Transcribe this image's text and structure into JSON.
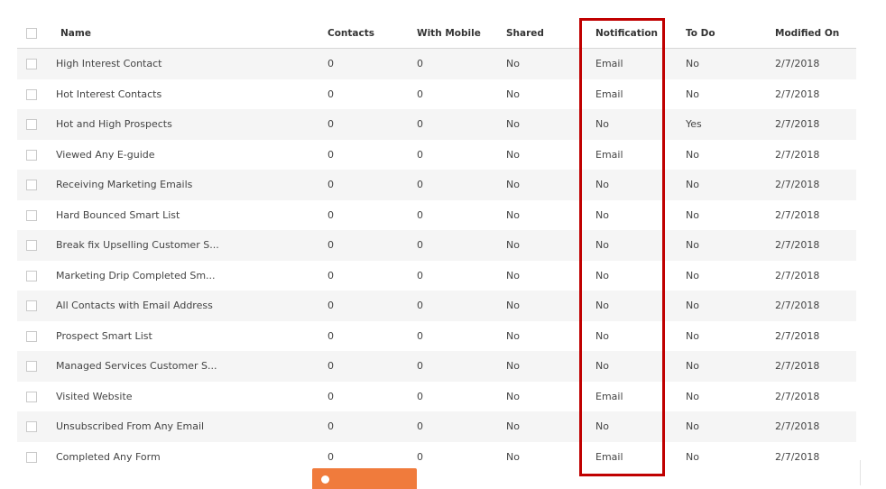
{
  "table": {
    "headers": {
      "name": "Name",
      "contacts": "Contacts",
      "with_mobile": "With Mobile",
      "shared": "Shared",
      "notification": "Notification",
      "to_do": "To Do",
      "modified_on": "Modified On"
    },
    "rows": [
      {
        "name": "High Interest Contact",
        "contacts": "0",
        "with_mobile": "0",
        "shared": "No",
        "notification": "Email",
        "to_do": "No",
        "modified_on": "2/7/2018"
      },
      {
        "name": "Hot Interest Contacts",
        "contacts": "0",
        "with_mobile": "0",
        "shared": "No",
        "notification": "Email",
        "to_do": "No",
        "modified_on": "2/7/2018"
      },
      {
        "name": "Hot and High Prospects",
        "contacts": "0",
        "with_mobile": "0",
        "shared": "No",
        "notification": "No",
        "to_do": "Yes",
        "modified_on": "2/7/2018"
      },
      {
        "name": "Viewed Any E-guide",
        "contacts": "0",
        "with_mobile": "0",
        "shared": "No",
        "notification": "Email",
        "to_do": "No",
        "modified_on": "2/7/2018"
      },
      {
        "name": "Receiving Marketing Emails",
        "contacts": "0",
        "with_mobile": "0",
        "shared": "No",
        "notification": "No",
        "to_do": "No",
        "modified_on": "2/7/2018"
      },
      {
        "name": "Hard Bounced Smart List",
        "contacts": "0",
        "with_mobile": "0",
        "shared": "No",
        "notification": "No",
        "to_do": "No",
        "modified_on": "2/7/2018"
      },
      {
        "name": "Break fix Upselling Customer S...",
        "contacts": "0",
        "with_mobile": "0",
        "shared": "No",
        "notification": "No",
        "to_do": "No",
        "modified_on": "2/7/2018"
      },
      {
        "name": "Marketing Drip Completed Sm...",
        "contacts": "0",
        "with_mobile": "0",
        "shared": "No",
        "notification": "No",
        "to_do": "No",
        "modified_on": "2/7/2018"
      },
      {
        "name": "All Contacts with Email Address",
        "contacts": "0",
        "with_mobile": "0",
        "shared": "No",
        "notification": "No",
        "to_do": "No",
        "modified_on": "2/7/2018"
      },
      {
        "name": "Prospect Smart List",
        "contacts": "0",
        "with_mobile": "0",
        "shared": "No",
        "notification": "No",
        "to_do": "No",
        "modified_on": "2/7/2018"
      },
      {
        "name": "Managed Services Customer S...",
        "contacts": "0",
        "with_mobile": "0",
        "shared": "No",
        "notification": "No",
        "to_do": "No",
        "modified_on": "2/7/2018"
      },
      {
        "name": "Visited Website",
        "contacts": "0",
        "with_mobile": "0",
        "shared": "No",
        "notification": "Email",
        "to_do": "No",
        "modified_on": "2/7/2018"
      },
      {
        "name": "Unsubscribed From Any Email",
        "contacts": "0",
        "with_mobile": "0",
        "shared": "No",
        "notification": "No",
        "to_do": "No",
        "modified_on": "2/7/2018"
      },
      {
        "name": "Completed Any Form",
        "contacts": "0",
        "with_mobile": "0",
        "shared": "No",
        "notification": "Email",
        "to_do": "No",
        "modified_on": "2/7/2018"
      }
    ]
  },
  "colors": {
    "highlight": "#c00000",
    "accent_button": "#f07b3c",
    "row_stripe": "#f5f5f5"
  }
}
